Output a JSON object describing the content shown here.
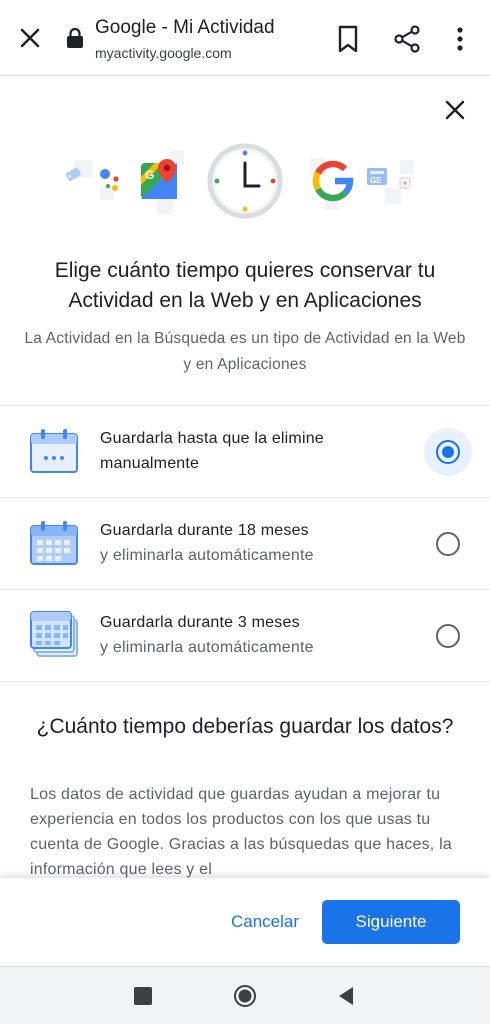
{
  "browser": {
    "title": "Google - Mi Actividad",
    "url": "myactivity.google.com",
    "icons": [
      "close-icon",
      "lock-icon",
      "bookmark-icon",
      "share-icon",
      "more-vert-icon"
    ]
  },
  "dialog": {
    "heading": "Elige cuánto tiempo quieres conservar tu Actividad en la Web y en Aplicaciones",
    "subheading": "La Actividad en la Búsqueda es un tipo de Actividad en la Web y en Aplicaciones",
    "options": [
      {
        "line1": "Guardarla hasta que la elimine",
        "line2": "manualmente",
        "selected": true
      },
      {
        "line1": "Guardarla durante 18 meses",
        "line2": "y eliminarla automáticamente",
        "selected": false
      },
      {
        "line1": "Guardarla durante 3 meses",
        "line2": "y eliminarla automáticamente",
        "selected": false
      }
    ],
    "question_title": "¿Cuánto tiempo deberías guardar los datos?",
    "question_body": "Los datos de actividad que guardas ayudan a mejorar tu experiencia en todos los productos con los que usas tu cuenta de Google. Gracias a las búsquedas que haces, la información que lees y el",
    "cancel_label": "Cancelar",
    "next_label": "Siguiente"
  },
  "colors": {
    "accent": "#1a73e8",
    "text": "#202124",
    "secondary_text": "#5f6368"
  }
}
